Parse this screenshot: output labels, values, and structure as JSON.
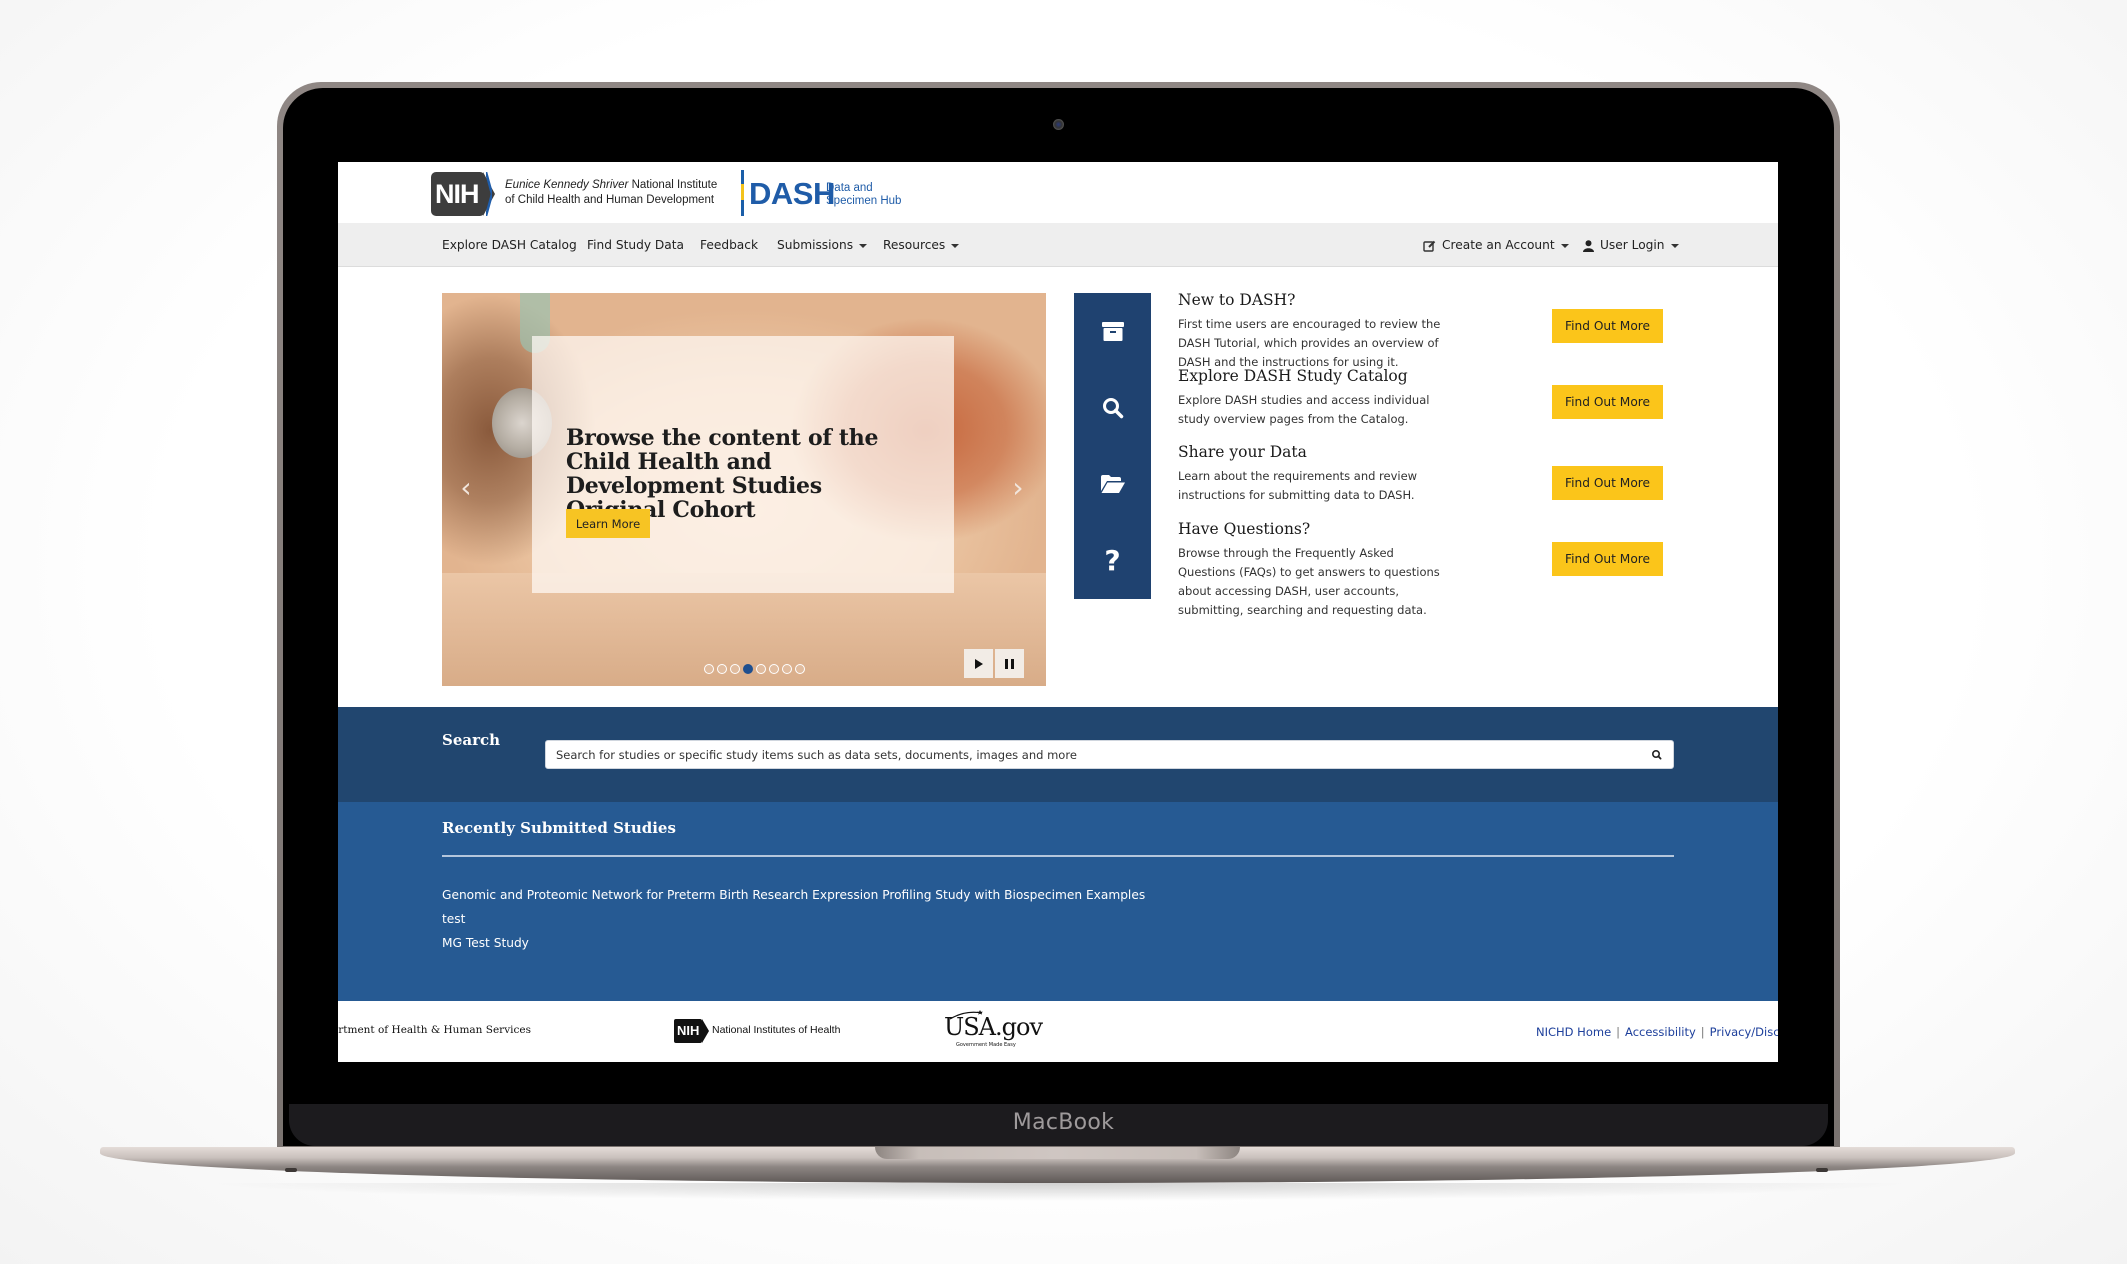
{
  "device": {
    "label": "MacBook"
  },
  "header": {
    "nih_logo": "NIH",
    "institute_italic": "Eunice Kennedy Shriver",
    "institute_line1_rest": " National Institute",
    "institute_line2": "of Child Health and Human Development",
    "dash_logo": "DASH",
    "dash_sub_line1": "Data and",
    "dash_sub_line2": "Specimen Hub"
  },
  "nav": {
    "items": [
      {
        "label": "Explore DASH Catalog",
        "dropdown": false
      },
      {
        "label": "Find Study Data",
        "dropdown": false
      },
      {
        "label": "Feedback",
        "dropdown": false
      },
      {
        "label": "Submissions",
        "dropdown": true
      },
      {
        "label": "Resources",
        "dropdown": true
      }
    ],
    "right": [
      {
        "label": "Create an Account",
        "icon": "edit-icon",
        "dropdown": true
      },
      {
        "label": "User Login",
        "icon": "user-icon",
        "dropdown": true
      }
    ]
  },
  "carousel": {
    "title": "Browse the content of the Child Health and Development Studies Original Cohort",
    "button": "Learn More",
    "prev_icon": "chevron-left-icon",
    "next_icon": "chevron-right-icon",
    "slide_count": 8,
    "active_slide": 4,
    "play_icon": "play-icon",
    "pause_icon": "pause-icon"
  },
  "features": [
    {
      "icon": "archive-box-icon",
      "title": "New to DASH?",
      "description": "First time users are encouraged to review the DASH Tutorial, which provides an overview of DASH and the instructions for using it.",
      "button": "Find Out More"
    },
    {
      "icon": "search-icon",
      "title": "Explore DASH Study Catalog",
      "description": "Explore DASH studies and access individual study overview pages from the Catalog.",
      "button": "Find Out More"
    },
    {
      "icon": "folder-open-icon",
      "title": "Share your Data",
      "description": "Learn about the requirements and review instructions for submitting data to DASH.",
      "button": "Find Out More"
    },
    {
      "icon": "question-icon",
      "title": "Have Questions?",
      "description": "Browse through the Frequently Asked Questions (FAQs) to get answers to questions about accessing DASH, user accounts, submitting, searching and requesting data.",
      "button": "Find Out More"
    }
  ],
  "search": {
    "label": "Search",
    "value": "",
    "placeholder": "Search for studies or specific study items such as data sets, documents, images and more"
  },
  "recent": {
    "title": "Recently Submitted Studies",
    "items": [
      "Genomic and Proteomic Network for Preterm Birth Research Expression Profiling Study with Biospecimen Examples",
      "test",
      "MG Test Study"
    ]
  },
  "footer": {
    "hhs": "artment of Health & Human Services",
    "nih_logo": "NIH",
    "nih_text": "National Institutes of Health",
    "usa_gov": "USA.gov",
    "usa_gov_tagline": "Government Made Easy",
    "links": [
      "NICHD Home",
      "Accessibility",
      "Privacy/Disc"
    ],
    "separator": "|"
  },
  "colors": {
    "brand_blue": "#1f5ca8",
    "navy": "#21466f",
    "icon_tile": "#1f4270",
    "recent_bg": "#265a93",
    "accent_yellow": "#fbc51a",
    "link_blue": "#1d3f9b"
  }
}
